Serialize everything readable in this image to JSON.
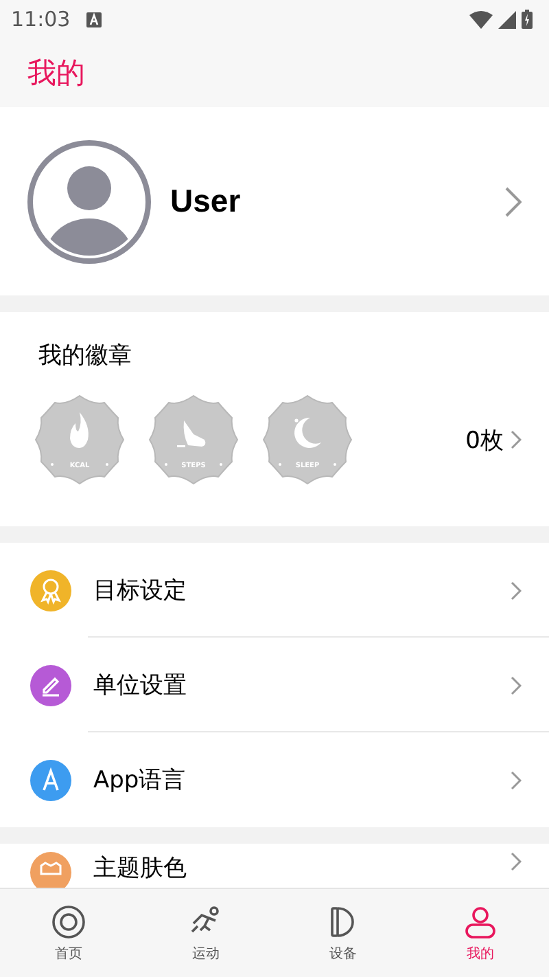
{
  "status_bar": {
    "time": "11:03"
  },
  "header": {
    "title": "我的"
  },
  "profile": {
    "name": "User"
  },
  "badges": {
    "title": "我的徽章",
    "count": "0枚",
    "items": [
      {
        "kind": "kcal",
        "label": "KCAL"
      },
      {
        "kind": "steps",
        "label": "STEPS"
      },
      {
        "kind": "sleep",
        "label": "SLEEP"
      }
    ]
  },
  "menu": [
    {
      "kind": "goal",
      "label": "目标设定",
      "color": "#f0b429"
    },
    {
      "kind": "unit",
      "label": "单位设置",
      "color": "#b65ad6"
    },
    {
      "kind": "language",
      "label": "App语言",
      "color": "#3d9cf0"
    }
  ],
  "menu_2": [
    {
      "kind": "theme",
      "label": "主题肤色",
      "color": "#f0a060"
    }
  ],
  "tabs": [
    {
      "kind": "home",
      "label": "首页",
      "selected": false
    },
    {
      "kind": "sport",
      "label": "运动",
      "selected": false
    },
    {
      "kind": "device",
      "label": "设备",
      "selected": false
    },
    {
      "kind": "mine",
      "label": "我的",
      "selected": true
    }
  ]
}
